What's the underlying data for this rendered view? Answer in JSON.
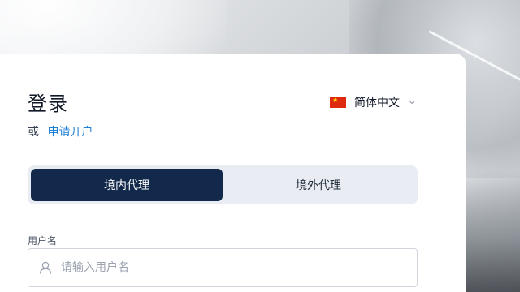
{
  "login": {
    "title": "登录",
    "or_text": "或",
    "register_link": "申请开户"
  },
  "language": {
    "flag_icon": "china-flag-icon",
    "label": "简体中文"
  },
  "tabs": [
    {
      "label": "境内代理",
      "active": true
    },
    {
      "label": "境外代理",
      "active": false
    }
  ],
  "username": {
    "label": "用户名",
    "placeholder": "请输入用户名",
    "value": ""
  },
  "colors": {
    "active_tab": "#13294b",
    "link": "#1d7fd6",
    "flag_red": "#de2910"
  }
}
